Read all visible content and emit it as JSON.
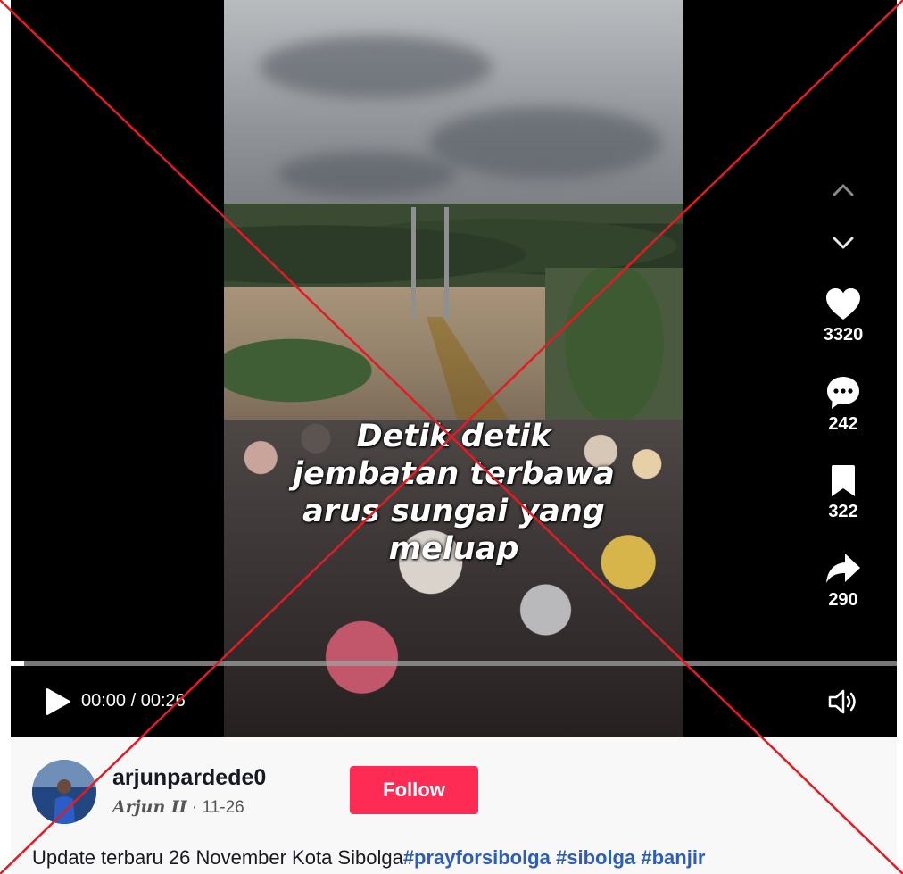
{
  "video": {
    "overlay_text": [
      "Detik detik",
      "jembatan terbawa",
      "arus sungai yang",
      "meluap"
    ],
    "progress_percent": 1.5,
    "current_time": "00:00",
    "time_separator": " / ",
    "duration": "00:26"
  },
  "icons": {
    "nav_up": "chevron-up-icon",
    "nav_down": "chevron-down-icon",
    "like": "heart-icon",
    "comment": "comment-icon",
    "save": "bookmark-icon",
    "share": "share-icon",
    "play": "play-icon",
    "volume": "volume-icon"
  },
  "actions": {
    "likes": "3320",
    "comments": "242",
    "saves": "322",
    "shares": "290"
  },
  "author": {
    "username": "arjunpardede0",
    "display_name": "Arjun II",
    "separator": " · ",
    "date": "11-26",
    "follow_label": "Follow"
  },
  "description": {
    "text": "Update terbaru 26 November Kota Sibolga",
    "hashtags": [
      "#prayforsibolga",
      "#sibolga",
      "#banjir"
    ]
  },
  "colors": {
    "follow_button": "#fe2c55",
    "hashtag": "#2b5db9",
    "cross_overlay": "#e41b23"
  }
}
